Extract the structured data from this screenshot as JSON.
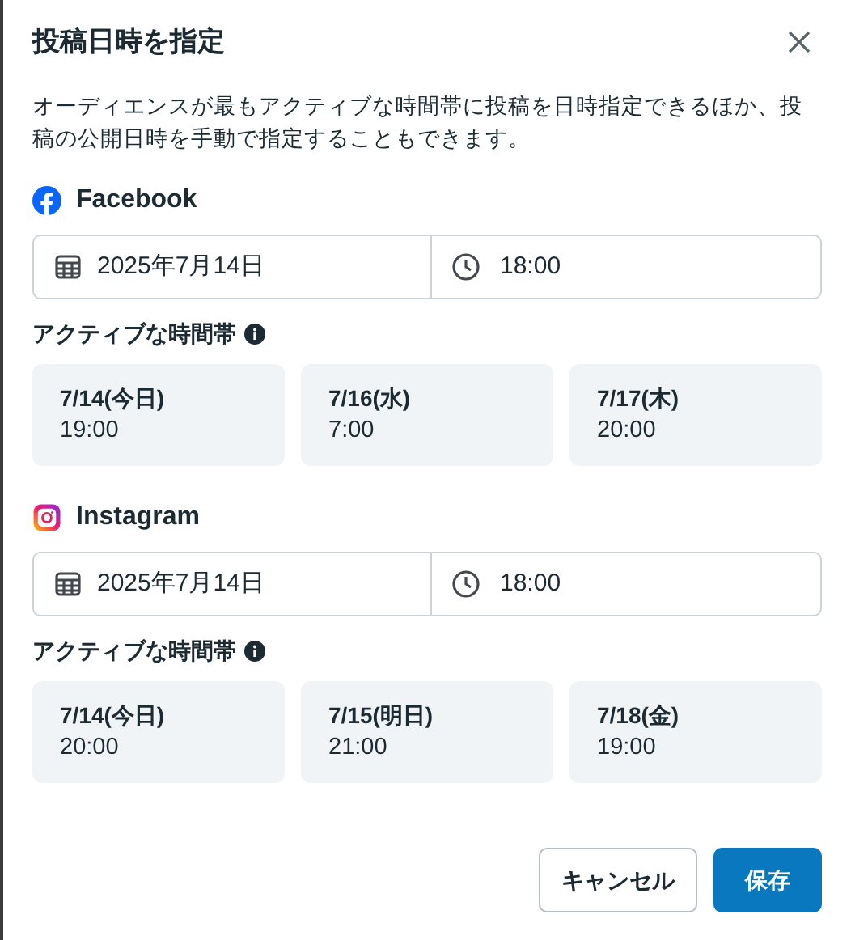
{
  "dialog": {
    "title": "投稿日時を指定",
    "description": "オーディエンスが最もアクティブな時間帯に投稿を日時指定できるほか、投稿の公開日時を手動で指定することもできます。"
  },
  "platforms": [
    {
      "kind": "facebook",
      "name": "Facebook",
      "date": "2025年7月14日",
      "time": "18:00",
      "active_label": "アクティブな時間帯",
      "slots": [
        {
          "date": "7/14(今日)",
          "time": "19:00"
        },
        {
          "date": "7/16(水)",
          "time": "7:00"
        },
        {
          "date": "7/17(木)",
          "time": "20:00"
        }
      ]
    },
    {
      "kind": "instagram",
      "name": "Instagram",
      "date": "2025年7月14日",
      "time": "18:00",
      "active_label": "アクティブな時間帯",
      "slots": [
        {
          "date": "7/14(今日)",
          "time": "20:00"
        },
        {
          "date": "7/15(明日)",
          "time": "21:00"
        },
        {
          "date": "7/18(金)",
          "time": "19:00"
        }
      ]
    }
  ],
  "buttons": {
    "cancel": "キャンセル",
    "save": "保存"
  }
}
